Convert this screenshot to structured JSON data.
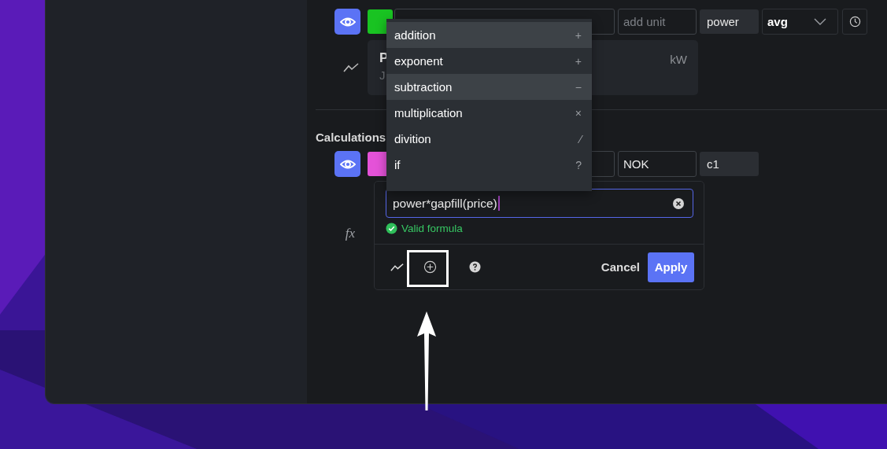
{
  "series_row": {
    "visible": true,
    "color": "#19c322",
    "unit_placeholder": "add unit",
    "variable": "power",
    "aggregation": "avg"
  },
  "series_card": {
    "title": "P",
    "subtitle": "J",
    "unit": "kW"
  },
  "calculations": {
    "heading": "Calculations",
    "visible": true,
    "color": "#e452d8",
    "unit": "NOK",
    "variable": "c1",
    "formula": "power*gapfill(price)",
    "validation": "Valid formula",
    "valid": true,
    "function_label": "fx",
    "cancel": "Cancel",
    "apply": "Apply"
  },
  "dropdown": [
    {
      "label": "addition",
      "symbol": "+",
      "selected": true
    },
    {
      "label": "exponent",
      "symbol": "+",
      "selected": false
    },
    {
      "label": "subtraction",
      "symbol": "−",
      "selected": true
    },
    {
      "label": "multiplication",
      "symbol": "×",
      "selected": false
    },
    {
      "label": "divition",
      "symbol": "⁄",
      "selected": false
    },
    {
      "label": "if",
      "symbol": "?",
      "selected": false
    }
  ]
}
